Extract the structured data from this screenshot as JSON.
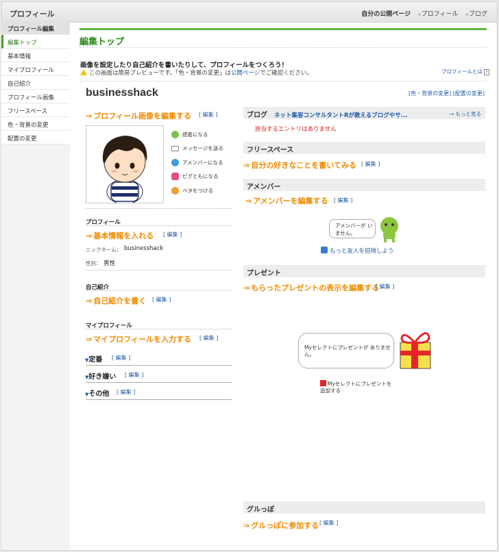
{
  "header": {
    "title": "プロフィール",
    "nav_bold": "自分の公開ページ",
    "nav": [
      "プロフィール",
      "ブログ"
    ]
  },
  "sidebar": {
    "heading": "プロフィール編集",
    "items": [
      "編集トップ",
      "基本情報",
      "マイプロフィール",
      "自己紹介",
      "プロフィール画像",
      "フリースペース",
      "色・背景の変更",
      "配置の変更"
    ]
  },
  "main": {
    "title": "編集トップ",
    "intro": "画像を設定したり自己紹介を書いたりして、プロフィールをつくろう！",
    "note_prefix": "この画面は簡易プレビューです。「色・背景の変更」は",
    "note_link": "公開ページ",
    "note_suffix": "でご確認ください。",
    "about_link": "プロフィールとは",
    "help_icon": "?",
    "username": "businesshack",
    "top_links": "[色・背景の変更] [配置の変更]",
    "edit_label": "[ 編集 ]"
  },
  "left": {
    "image_link": "プロフィール画像を編集する",
    "actions": [
      {
        "label": "読者になる",
        "icon": "reader-icon",
        "color": "#7cc24a"
      },
      {
        "label": "メッセージを送る",
        "icon": "mail-icon",
        "color": "#888888"
      },
      {
        "label": "アメンバーになる",
        "icon": "amember-icon",
        "color": "#3aa0d8"
      },
      {
        "label": "ピグともになる",
        "icon": "pigg-icon",
        "color": "#e84a8a"
      },
      {
        "label": "ペタをつける",
        "icon": "peta-icon",
        "color": "#f0a030"
      }
    ],
    "profile_heading": "プロフィール",
    "basic_link": "基本情報を入れる",
    "nickname_label": "ニックネーム：",
    "nickname": "businesshack",
    "gender_label": "性別：",
    "gender": "男性",
    "intro_heading": "自己紹介",
    "intro_link": "自己紹介を書く",
    "myprofile_heading": "マイプロフィール",
    "myprofile_link": "マイプロフィールを入力する",
    "toggles": [
      "定番",
      "好き嫌い",
      "その他"
    ]
  },
  "right": {
    "blog_heading": "ブログ",
    "blog_title": "ネット集客コンサルタントRが教えるブログやサ...",
    "blog_more": "→ もっと見る",
    "blog_empty": "該当するエントリはありません",
    "free_heading": "フリースペース",
    "free_link": "自分の好きなことを書いてみる",
    "amember_heading": "アメンバー",
    "amember_link": "アメンバーを編集する",
    "amember_bubble": "アメンバーが いません。",
    "amember_invite": "もっと友人を招待しよう",
    "present_heading": "プレゼント",
    "present_link": "もらったプレゼントの表示を編集する",
    "present_bubble": "Myセレクトにプレゼントが ありません。",
    "present_add": "Myセレクトにプレゼントを追加する",
    "gurupo_heading": "グルっぽ",
    "gurupo_link": "グルっぽに参加する"
  }
}
